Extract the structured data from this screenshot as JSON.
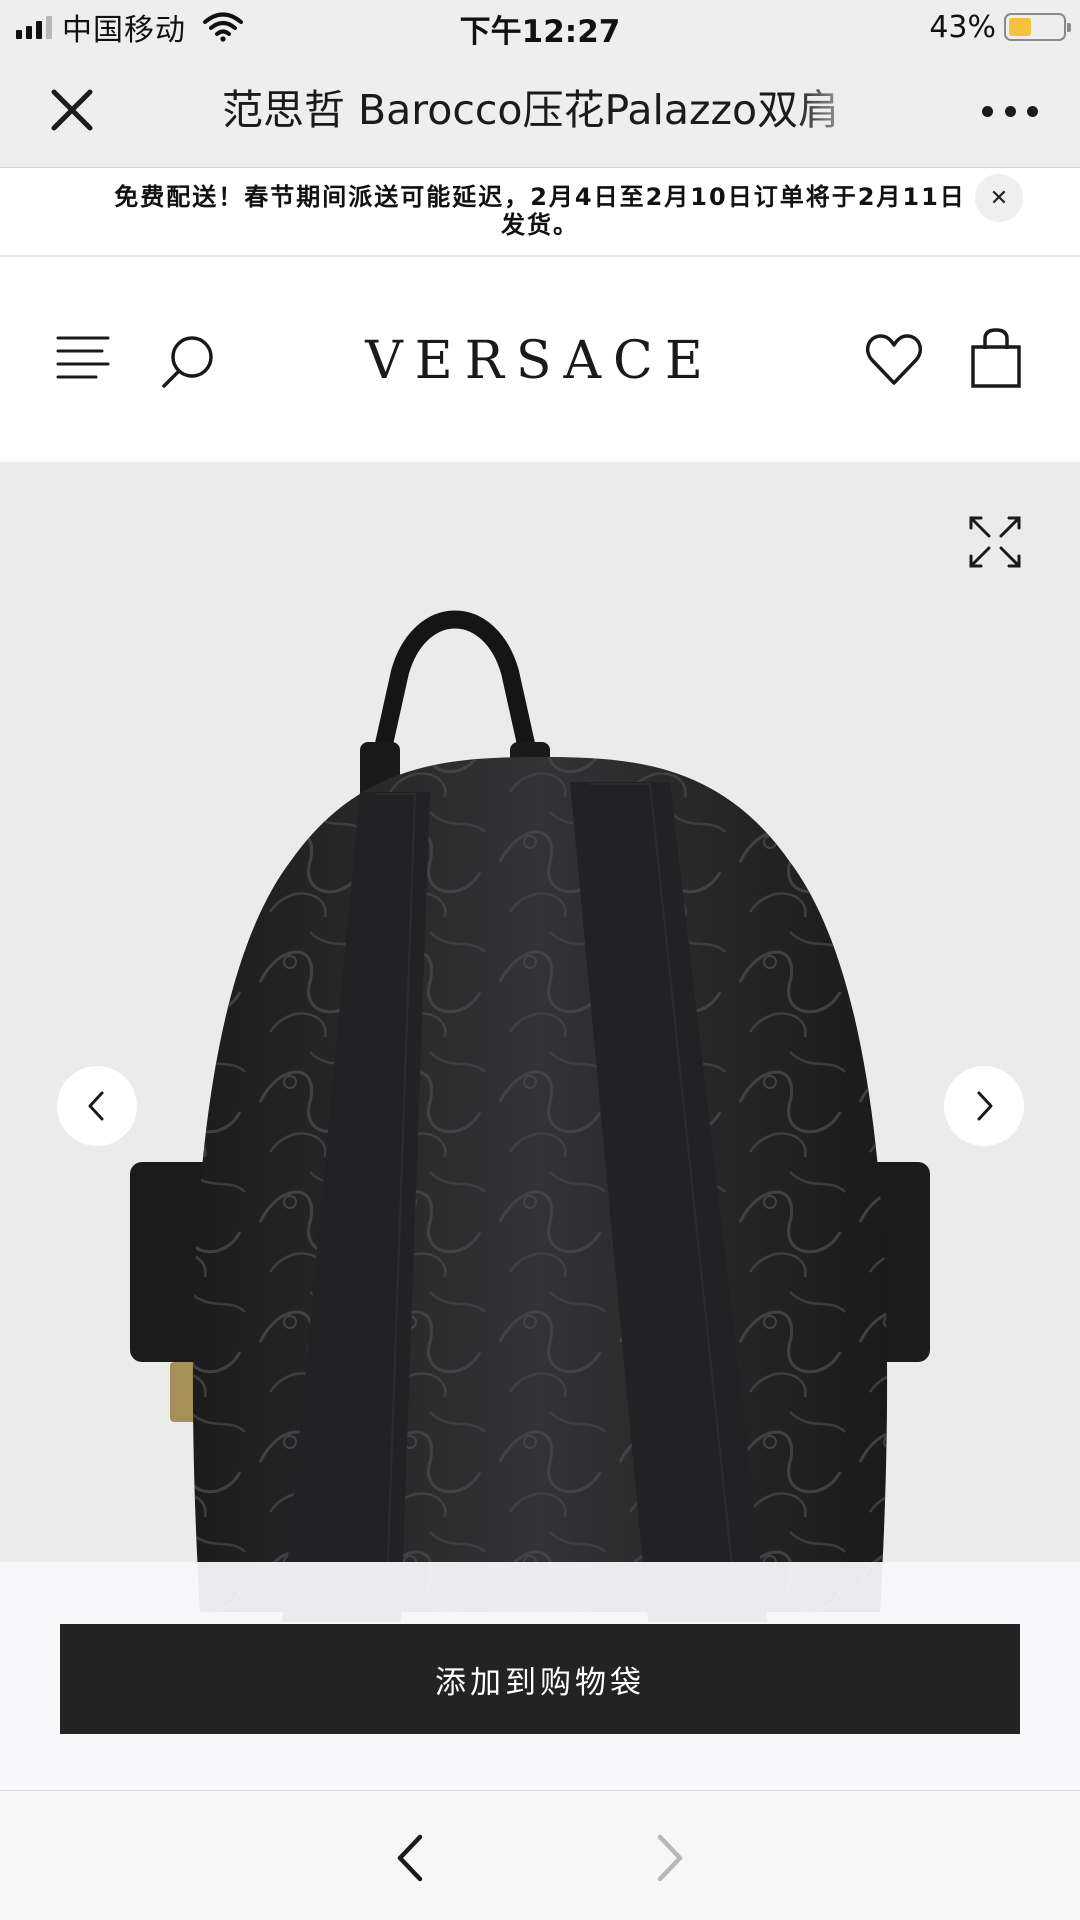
{
  "status_bar": {
    "carrier": "中国移动",
    "time": "下午12:27",
    "battery_percent": "43%",
    "battery_level": 0.43,
    "battery_color": "#f6c23b"
  },
  "titlebar": {
    "close_icon": "close-icon",
    "title": "范思哲 Barocco压花Palazzo双肩",
    "more_icon": "more-icon"
  },
  "promo": {
    "text": "免费配送！春节期间派送可能延迟，2月4日至2月10日订单将于2月11日发货。",
    "close_label": "✕"
  },
  "header": {
    "brand": "VERSACE",
    "menu_icon": "menu-icon",
    "search_icon": "search-icon",
    "wishlist_icon": "heart-icon",
    "bag_icon": "shopping-bag-icon"
  },
  "gallery": {
    "expand_icon": "expand-icon",
    "prev_icon": "chevron-left-icon",
    "next_icon": "chevron-right-icon",
    "background": "#ebebeb"
  },
  "cta": {
    "add_to_bag_label": "添加到购物袋",
    "button_color": "#232323"
  },
  "browser_nav": {
    "back_icon": "chevron-left-icon",
    "forward_icon": "chevron-right-icon"
  }
}
